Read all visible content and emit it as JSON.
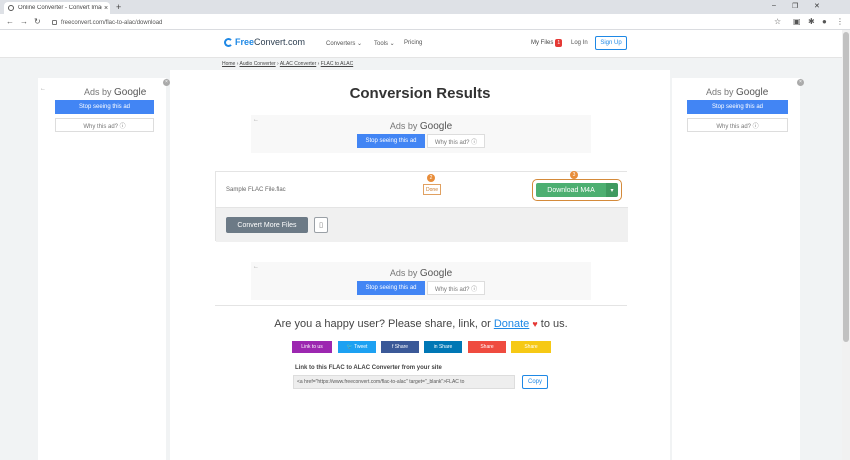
{
  "browser": {
    "tab_title": "Online Converter - Convert Imag",
    "tab_close": "×",
    "new_tab": "+",
    "url": "freeconvert.com/flac-to-alac/download",
    "window_min": "–",
    "window_max": "❐",
    "window_close": "✕"
  },
  "header": {
    "logo_prefix": "Free",
    "logo_main": "Convert.com",
    "nav": [
      "Converters ⌄",
      "Tools ⌄",
      "Pricing"
    ],
    "my_files": "My Files",
    "my_files_count": "1",
    "login": "Log In",
    "signup": "Sign Up"
  },
  "breadcrumb": {
    "items": [
      "Home",
      "Audio Converter",
      "ALAC Converter",
      "FLAC to ALAC"
    ],
    "separator": " › "
  },
  "ads": {
    "ads_by": "Ads by",
    "google": "Google",
    "stop": "Stop seeing this ad",
    "why": "Why this ad? ⓘ"
  },
  "main": {
    "title": "Conversion Results",
    "file_name": "Sample FLAC File.flac",
    "status": "Done",
    "step_badge_status": "2",
    "step_badge_download": "3",
    "download_label": "Download M4A",
    "convert_more": "Convert More Files"
  },
  "share": {
    "text": "Are you a happy user? Please share, link, or",
    "donate": "Donate",
    "to_us": "to us.",
    "buttons": [
      {
        "label": "Link to us",
        "color": "#9c27b0"
      },
      {
        "label": "🐦 Tweet",
        "color": "#1da1f2"
      },
      {
        "label": "f Share",
        "color": "#3b5998"
      },
      {
        "label": "in Share",
        "color": "#0077b5"
      },
      {
        "label": "Share",
        "color": "#ef4b3f"
      },
      {
        "label": "Share",
        "color": "#f6c915"
      }
    ],
    "link_label": "Link to this FLAC to ALAC Converter from your site",
    "link_code": "<a href=\"https://www.freeconvert.com/flac-to-alac\" target=\"_blank\">FLAC to",
    "copy": "Copy"
  }
}
